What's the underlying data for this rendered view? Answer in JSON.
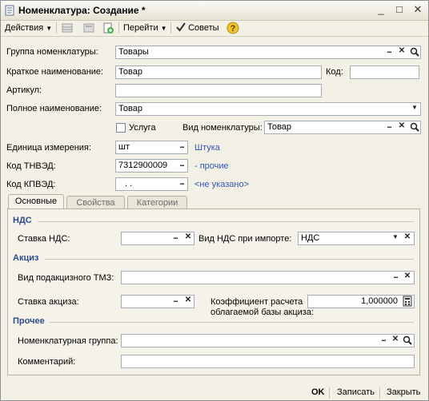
{
  "window": {
    "title": "Номенклатура: Создание *"
  },
  "toolbar": {
    "actions": "Действия",
    "goto": "Перейти",
    "tips": "Советы"
  },
  "form": {
    "group_label": "Группа номенклатуры:",
    "group_value": "Товары",
    "short_name_label": "Краткое наименование:",
    "short_name_value": "Товар",
    "code_label": "Код:",
    "code_value": "",
    "article_label": "Артикул:",
    "article_value": "",
    "full_name_label": "Полное наименование:",
    "full_name_value": "Товар",
    "service_label": "Услуга",
    "service_checked": false,
    "kind_label": "Вид номенклатуры:",
    "kind_value": "Товар",
    "unit_label": "Единица измерения:",
    "unit_value": "шт",
    "unit_link": "Штука",
    "tnved_label": "Код ТНВЭД:",
    "tnved_value": "7312900009",
    "tnved_link": "- прочие",
    "kpved_label": "Код КПВЭД:",
    "kpved_value": ". .",
    "kpved_link": "<не указано>"
  },
  "tabs": [
    {
      "label": "Основные"
    },
    {
      "label": "Свойства"
    },
    {
      "label": "Категории"
    }
  ],
  "main_tab": {
    "vat_section": "НДС",
    "vat_rate_label": "Ставка НДС:",
    "vat_rate_value": "",
    "import_vat_label": "Вид НДС при импорте:",
    "import_vat_value": "НДС",
    "excise_section": "Акциз",
    "excise_type_label": "Вид подакцизного ТМЗ:",
    "excise_type_value": "",
    "excise_rate_label": "Ставка акциза:",
    "excise_rate_value": "",
    "coef_label_line1": "Коэффициент расчета",
    "coef_label_line2": "облагаемой базы акциза:",
    "coef_value": "1,000000",
    "other_section": "Прочее",
    "nom_group_label": "Номенклатурная группа:",
    "nom_group_value": "",
    "comment_label": "Комментарий:",
    "comment_value": ""
  },
  "footer": {
    "ok": "OK",
    "save": "Записать",
    "close": "Закрыть"
  }
}
